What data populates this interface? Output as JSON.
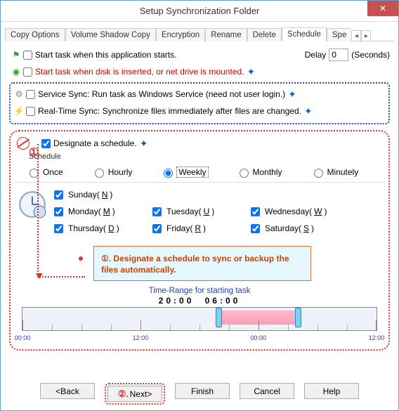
{
  "window": {
    "title": "Setup Synchronization Folder"
  },
  "tabs": {
    "items": [
      "Copy Options",
      "Volume Shadow Copy",
      "Encryption",
      "Rename",
      "Delete",
      "Schedule",
      "Spe"
    ],
    "nav_left": "◂",
    "nav_right": "▸"
  },
  "options": {
    "start_on_app": "Start task when this application starts.",
    "delay_label": "Delay",
    "delay_value": "0",
    "delay_unit": "(Seconds)",
    "start_on_disk": "Start task when disk is inserted, or net drive is mounted.",
    "service_sync": "Service Sync: Run task as Windows Service (need not user login.)",
    "realtime_sync": "Real-Time Sync: Synchronize files immediately after files are changed."
  },
  "schedule": {
    "designate": "Designate a schedule.",
    "group_label": "Schedule",
    "freq": {
      "once": "Once",
      "hourly": "Hourly",
      "weekly": "Weekly",
      "monthly": "Monthly",
      "minutely": "Minutely"
    },
    "days": {
      "sun": {
        "label": "Sunday(",
        "k": "N",
        "tail": ")"
      },
      "mon": {
        "label": "Monday(",
        "k": "M",
        "tail": ")"
      },
      "tue": {
        "label": "Tuesday(",
        "k": "U",
        "tail": ")"
      },
      "wed": {
        "label": "Wednesday(",
        "k": "W",
        "tail": ")"
      },
      "thu": {
        "label": "Thursday(",
        "k": "D",
        "tail": ")"
      },
      "fri": {
        "label": "Friday(",
        "k": "R",
        "tail": ")"
      },
      "sat": {
        "label": "Saturday(",
        "k": "S",
        "tail": ")"
      }
    },
    "callout_num": "①.",
    "callout_text": " Designate a schedule to sync or backup the files automatically.",
    "time_range_label": "Time-Range for starting task",
    "time_start": "20:00",
    "time_end": "06:00",
    "ticks": {
      "t0": "00:00",
      "t12a": "12:00",
      "t24": "00:00",
      "t12b": "12:00"
    }
  },
  "annot": {
    "one": "①",
    "two": "②."
  },
  "buttons": {
    "back": "<Back",
    "next": " Next>",
    "finish": "Finish",
    "cancel": "Cancel",
    "help": "Help"
  }
}
